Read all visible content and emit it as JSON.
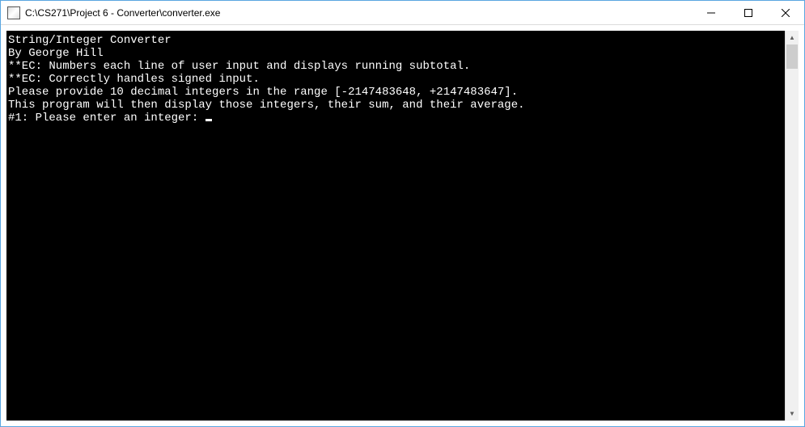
{
  "window": {
    "title": "C:\\CS271\\Project 6 - Converter\\converter.exe"
  },
  "console": {
    "lines": [
      "String/Integer Converter",
      "By George Hill",
      "",
      "**EC: Numbers each line of user input and displays running subtotal.",
      "**EC: Correctly handles signed input.",
      "",
      "Please provide 10 decimal integers in the range [-2147483648, +2147483647].",
      "This program will then display those integers, their sum, and their average.",
      "",
      "#1: Please enter an integer: "
    ],
    "cursor_on_last_line": true
  }
}
